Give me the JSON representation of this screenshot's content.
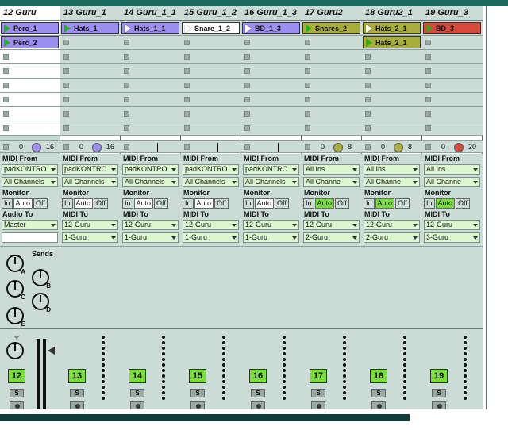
{
  "colors": {
    "track_bg": "#cbdbd6",
    "clip_purple": "#9c8ef2",
    "clip_olive": "#a9ad3a",
    "clip_red": "#d64b3e",
    "green_on": "#77e036",
    "dropdown_bg": "#dcf7cf"
  },
  "tracks": [
    {
      "name": "12 Guru",
      "number": "12",
      "clips": [
        {
          "label": "Perc_1",
          "color": "#9c8ef2",
          "playing": true
        },
        {
          "label": "Perc_2",
          "color": "#9c8ef2",
          "playing": true
        }
      ],
      "ctrl": {
        "left": "0",
        "right": "16",
        "dot_color": "#9c8ef2"
      },
      "io": {
        "from_label": "MIDI From",
        "from": "padKONTRO",
        "channel": "All Channels",
        "monitor_label": "Monitor",
        "mon_active": "",
        "to_label": "Audio To",
        "to": "Master",
        "to2": ""
      },
      "solo": "S"
    },
    {
      "name": "13 Guru_1",
      "number": "13",
      "clips": [
        {
          "label": "Hats_1",
          "color": "#9c8ef2",
          "playing": true
        }
      ],
      "ctrl": {
        "left": "0",
        "right": "16",
        "dot_color": "#9c8ef2"
      },
      "io": {
        "from_label": "MIDI From",
        "from": "padKONTRO",
        "channel": "All Channels",
        "monitor_label": "Monitor",
        "mon_active": "",
        "to_label": "MIDI To",
        "to": "12-Guru",
        "to2": "1-Guru"
      },
      "solo": "S"
    },
    {
      "name": "14 Guru_1_1",
      "number": "14",
      "clips": [
        {
          "label": "Hats_1_1",
          "color": "#9c8ef2",
          "playing": false
        }
      ],
      "ctrl": {
        "left": "",
        "right": "",
        "dot_color": ""
      },
      "io": {
        "from_label": "MIDI From",
        "from": "padKONTRO",
        "channel": "All Channels",
        "monitor_label": "Monitor",
        "mon_active": "",
        "to_label": "MIDI To",
        "to": "12-Guru",
        "to2": "1-Guru"
      },
      "solo": "S"
    },
    {
      "name": "15 Guru_1_2",
      "number": "15",
      "clips": [
        {
          "label": "Snare_1_2",
          "color": "#ffffff",
          "playing": false
        }
      ],
      "ctrl": {
        "left": "",
        "right": "",
        "dot_color": ""
      },
      "io": {
        "from_label": "MIDI From",
        "from": "padKONTRO",
        "channel": "All Channels",
        "monitor_label": "Monitor",
        "mon_active": "",
        "to_label": "MIDI To",
        "to": "12-Guru",
        "to2": "1-Guru"
      },
      "solo": "S"
    },
    {
      "name": "16 Guru_1_3",
      "number": "16",
      "clips": [
        {
          "label": "BD_1_3",
          "color": "#9c8ef2",
          "playing": false
        }
      ],
      "ctrl": {
        "left": "",
        "right": "",
        "dot_color": ""
      },
      "io": {
        "from_label": "MIDI From",
        "from": "padKONTRO",
        "channel": "All Channels",
        "monitor_label": "Monitor",
        "mon_active": "",
        "to_label": "MIDI To",
        "to": "12-Guru",
        "to2": "1-Guru"
      },
      "solo": "S"
    },
    {
      "name": "17 Guru2",
      "number": "17",
      "clips": [
        {
          "label": "Snares_2",
          "color": "#a9ad3a",
          "playing": true
        }
      ],
      "ctrl": {
        "left": "0",
        "right": "8",
        "dot_color": "#a9ad3a"
      },
      "io": {
        "from_label": "MIDI From",
        "from": "All Ins",
        "channel": "All Channe",
        "monitor_label": "Monitor",
        "mon_active": "Auto",
        "to_label": "MIDI To",
        "to": "12-Guru",
        "to2": "2-Guru"
      },
      "solo": "S"
    },
    {
      "name": "18 Guru2_1",
      "number": "18",
      "clips": [
        {
          "label": "Hats_2_1",
          "color": "#a9ad3a",
          "playing": false
        },
        {
          "label": "Hats_2_1",
          "color": "#a9ad3a",
          "playing": true
        }
      ],
      "ctrl": {
        "left": "0",
        "right": "8",
        "dot_color": "#a9ad3a"
      },
      "io": {
        "from_label": "MIDI From",
        "from": "All Ins",
        "channel": "All Channe",
        "monitor_label": "Monitor",
        "mon_active": "Auto",
        "to_label": "MIDI To",
        "to": "12-Guru",
        "to2": "2-Guru"
      },
      "solo": "S"
    },
    {
      "name": "19 Guru_3",
      "number": "19",
      "clips": [
        {
          "label": "BD_3",
          "color": "#d64b3e",
          "playing": true
        }
      ],
      "ctrl": {
        "left": "0",
        "right": "20",
        "dot_color": "#d64b3e"
      },
      "io": {
        "from_label": "MIDI From",
        "from": "All Ins",
        "channel": "All Channe",
        "monitor_label": "Monitor",
        "mon_active": "Auto",
        "to_label": "MIDI To",
        "to": "12-Guru",
        "to2": "3-Guru"
      },
      "solo": "S"
    }
  ],
  "monitor_options": [
    "In",
    "Auto",
    "Off"
  ],
  "sends": {
    "label": "Sends",
    "knobs": [
      "A",
      "B",
      "C",
      "D",
      "E"
    ]
  }
}
